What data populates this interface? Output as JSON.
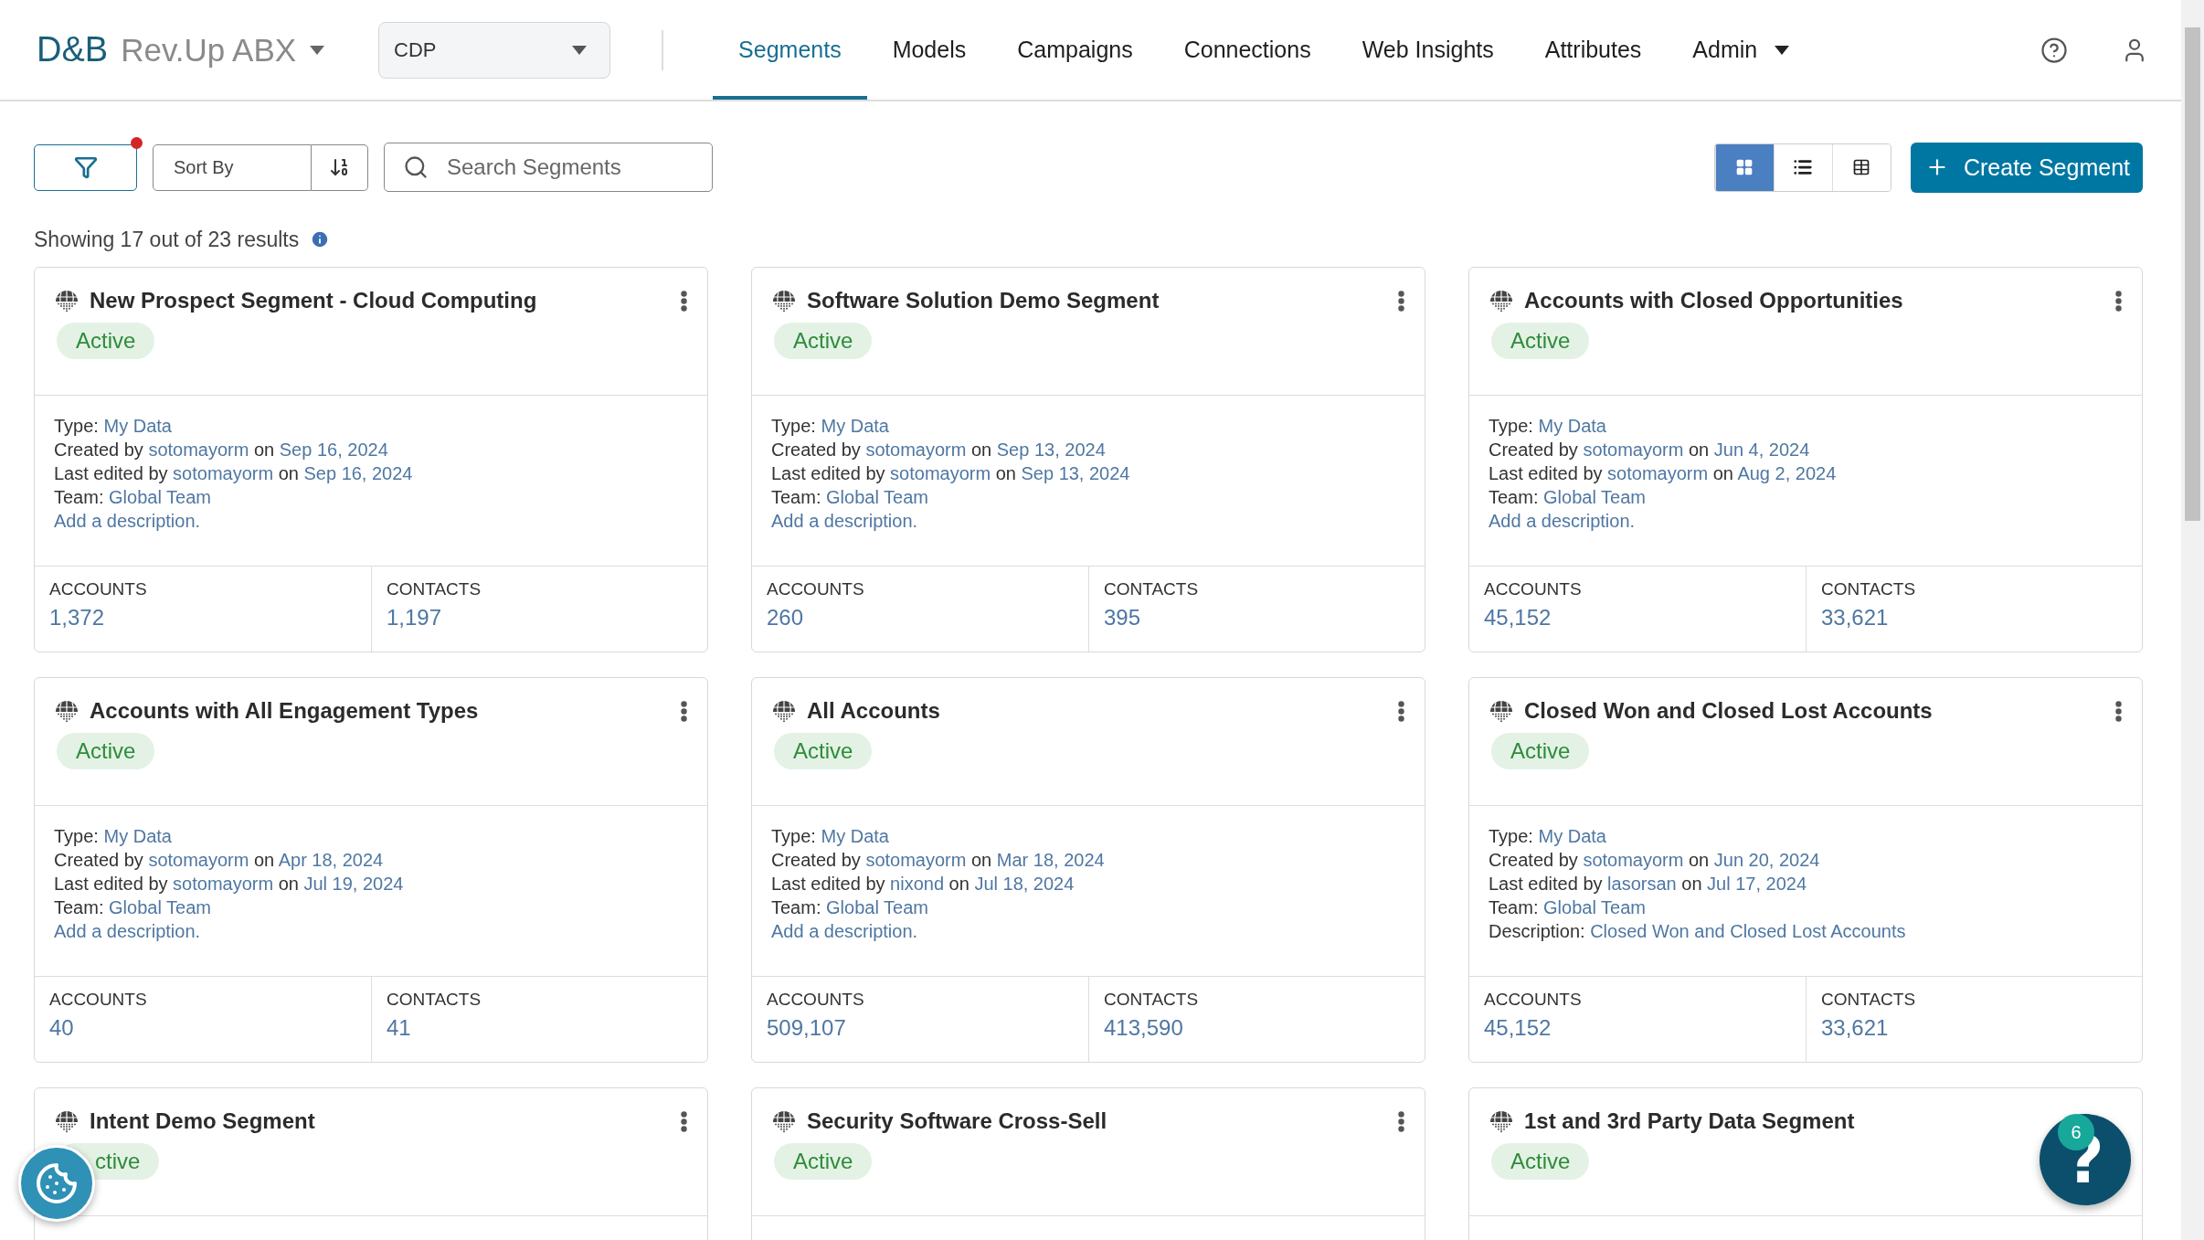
{
  "header": {
    "logo": {
      "brand": "D&B",
      "product": "Rev.Up ABX"
    },
    "workspace_select": {
      "value": "CDP"
    },
    "nav": [
      {
        "label": "Segments",
        "selected": true,
        "dropdown": false
      },
      {
        "label": "Models",
        "selected": false,
        "dropdown": false
      },
      {
        "label": "Campaigns",
        "selected": false,
        "dropdown": false
      },
      {
        "label": "Connections",
        "selected": false,
        "dropdown": false
      },
      {
        "label": "Web Insights",
        "selected": false,
        "dropdown": false
      },
      {
        "label": "Attributes",
        "selected": false,
        "dropdown": false
      },
      {
        "label": "Admin",
        "selected": false,
        "dropdown": true
      }
    ]
  },
  "toolbar": {
    "filter_active": true,
    "sort": {
      "placeholder": "Sort By"
    },
    "search": {
      "placeholder": "Search Segments"
    },
    "views": [
      {
        "kind": "grid",
        "selected": true
      },
      {
        "kind": "list",
        "selected": false
      },
      {
        "kind": "table",
        "selected": false
      }
    ],
    "create_button": "Create Segment"
  },
  "results_summary": "Showing 17 out of 23 results",
  "segments": [
    {
      "title": "New Prospect Segment - Cloud Computing",
      "status": "Active",
      "details": [
        [
          {
            "t": "Type: ",
            "kind": "text"
          },
          {
            "t": "My Data",
            "kind": "link"
          }
        ],
        [
          {
            "t": "Created by ",
            "kind": "text"
          },
          {
            "t": "sotomayorm",
            "kind": "link"
          },
          {
            "t": " on ",
            "kind": "text"
          },
          {
            "t": "Sep 16, 2024",
            "kind": "link"
          }
        ],
        [
          {
            "t": "Last edited by ",
            "kind": "text"
          },
          {
            "t": "sotomayorm",
            "kind": "link"
          },
          {
            "t": " on ",
            "kind": "text"
          },
          {
            "t": "Sep 16, 2024",
            "kind": "link"
          }
        ],
        [
          {
            "t": "Team: ",
            "kind": "text"
          },
          {
            "t": "Global Team",
            "kind": "link"
          }
        ],
        [
          {
            "t": "Add a description.",
            "kind": "link"
          }
        ]
      ],
      "stats": [
        {
          "label": "ACCOUNTS",
          "value": "1,372"
        },
        {
          "label": "CONTACTS",
          "value": "1,197"
        }
      ]
    },
    {
      "title": "Software Solution Demo Segment",
      "status": "Active",
      "details": [
        [
          {
            "t": "Type: ",
            "kind": "text"
          },
          {
            "t": "My Data",
            "kind": "link"
          }
        ],
        [
          {
            "t": "Created by ",
            "kind": "text"
          },
          {
            "t": "sotomayorm",
            "kind": "link"
          },
          {
            "t": " on ",
            "kind": "text"
          },
          {
            "t": "Sep 13, 2024",
            "kind": "link"
          }
        ],
        [
          {
            "t": "Last edited by ",
            "kind": "text"
          },
          {
            "t": "sotomayorm",
            "kind": "link"
          },
          {
            "t": " on ",
            "kind": "text"
          },
          {
            "t": "Sep 13, 2024",
            "kind": "link"
          }
        ],
        [
          {
            "t": "Team: ",
            "kind": "text"
          },
          {
            "t": "Global Team",
            "kind": "link"
          }
        ],
        [
          {
            "t": "Add a description.",
            "kind": "link"
          }
        ]
      ],
      "stats": [
        {
          "label": "ACCOUNTS",
          "value": "260"
        },
        {
          "label": "CONTACTS",
          "value": "395"
        }
      ]
    },
    {
      "title": "Accounts with Closed Opportunities",
      "status": "Active",
      "details": [
        [
          {
            "t": "Type: ",
            "kind": "text"
          },
          {
            "t": "My Data",
            "kind": "link"
          }
        ],
        [
          {
            "t": "Created by ",
            "kind": "text"
          },
          {
            "t": "sotomayorm",
            "kind": "link"
          },
          {
            "t": " on ",
            "kind": "text"
          },
          {
            "t": "Jun 4, 2024",
            "kind": "link"
          }
        ],
        [
          {
            "t": "Last edited by ",
            "kind": "text"
          },
          {
            "t": "sotomayorm",
            "kind": "link"
          },
          {
            "t": " on ",
            "kind": "text"
          },
          {
            "t": "Aug 2, 2024",
            "kind": "link"
          }
        ],
        [
          {
            "t": "Team: ",
            "kind": "text"
          },
          {
            "t": "Global Team",
            "kind": "link"
          }
        ],
        [
          {
            "t": "Add a description.",
            "kind": "link"
          }
        ]
      ],
      "stats": [
        {
          "label": "ACCOUNTS",
          "value": "45,152"
        },
        {
          "label": "CONTACTS",
          "value": "33,621"
        }
      ]
    },
    {
      "title": "Accounts with All Engagement Types",
      "status": "Active",
      "details": [
        [
          {
            "t": "Type: ",
            "kind": "text"
          },
          {
            "t": "My Data",
            "kind": "link"
          }
        ],
        [
          {
            "t": "Created by ",
            "kind": "text"
          },
          {
            "t": "sotomayorm",
            "kind": "link"
          },
          {
            "t": " on ",
            "kind": "text"
          },
          {
            "t": "Apr 18, 2024",
            "kind": "link"
          }
        ],
        [
          {
            "t": "Last edited by ",
            "kind": "text"
          },
          {
            "t": "sotomayorm",
            "kind": "link"
          },
          {
            "t": " on ",
            "kind": "text"
          },
          {
            "t": "Jul 19, 2024",
            "kind": "link"
          }
        ],
        [
          {
            "t": "Team: ",
            "kind": "text"
          },
          {
            "t": "Global Team",
            "kind": "link"
          }
        ],
        [
          {
            "t": "Add a description.",
            "kind": "link"
          }
        ]
      ],
      "stats": [
        {
          "label": "ACCOUNTS",
          "value": "40"
        },
        {
          "label": "CONTACTS",
          "value": "41"
        }
      ]
    },
    {
      "title": "All Accounts",
      "status": "Active",
      "details": [
        [
          {
            "t": "Type: ",
            "kind": "text"
          },
          {
            "t": "My Data",
            "kind": "link"
          }
        ],
        [
          {
            "t": "Created by ",
            "kind": "text"
          },
          {
            "t": "sotomayorm",
            "kind": "link"
          },
          {
            "t": " on ",
            "kind": "text"
          },
          {
            "t": "Mar 18, 2024",
            "kind": "link"
          }
        ],
        [
          {
            "t": "Last edited by ",
            "kind": "text"
          },
          {
            "t": "nixond",
            "kind": "link"
          },
          {
            "t": " on ",
            "kind": "text"
          },
          {
            "t": "Jul 18, 2024",
            "kind": "link"
          }
        ],
        [
          {
            "t": "Team: ",
            "kind": "text"
          },
          {
            "t": "Global Team",
            "kind": "link"
          }
        ],
        [
          {
            "t": "Add a description.",
            "kind": "link"
          }
        ]
      ],
      "stats": [
        {
          "label": "ACCOUNTS",
          "value": "509,107"
        },
        {
          "label": "CONTACTS",
          "value": "413,590"
        }
      ]
    },
    {
      "title": "Closed Won and Closed Lost Accounts",
      "status": "Active",
      "details": [
        [
          {
            "t": "Type: ",
            "kind": "text"
          },
          {
            "t": "My Data",
            "kind": "link"
          }
        ],
        [
          {
            "t": "Created by ",
            "kind": "text"
          },
          {
            "t": "sotomayorm",
            "kind": "link"
          },
          {
            "t": " on ",
            "kind": "text"
          },
          {
            "t": "Jun 20, 2024",
            "kind": "link"
          }
        ],
        [
          {
            "t": "Last edited by ",
            "kind": "text"
          },
          {
            "t": "lasorsan",
            "kind": "link"
          },
          {
            "t": " on ",
            "kind": "text"
          },
          {
            "t": "Jul 17, 2024",
            "kind": "link"
          }
        ],
        [
          {
            "t": "Team: ",
            "kind": "text"
          },
          {
            "t": "Global Team",
            "kind": "link"
          }
        ],
        [
          {
            "t": "Description: ",
            "kind": "text"
          },
          {
            "t": "Closed Won and Closed Lost Accounts",
            "kind": "link"
          }
        ]
      ],
      "stats": [
        {
          "label": "ACCOUNTS",
          "value": "45,152"
        },
        {
          "label": "CONTACTS",
          "value": "33,621"
        }
      ]
    },
    {
      "title": "Intent Demo Segment",
      "status": "ctive",
      "status_cut": true,
      "menu": true
    },
    {
      "title": "Security Software Cross-Sell",
      "status": "Active",
      "menu": true
    },
    {
      "title": "1st and 3rd Party Data Segment",
      "status": "Active",
      "menu": false
    }
  ],
  "help_button": {
    "label": "?",
    "badge": "6"
  }
}
